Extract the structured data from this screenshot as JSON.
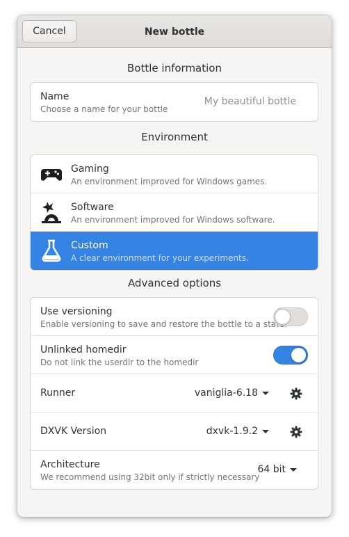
{
  "header": {
    "cancel_label": "Cancel",
    "title": "New bottle"
  },
  "bottle_info": {
    "section_title": "Bottle information",
    "name_label": "Name",
    "name_sub": "Choose a name for your bottle",
    "name_placeholder": "My beautiful bottle"
  },
  "environment": {
    "section_title": "Environment",
    "items": [
      {
        "label": "Gaming",
        "sub": "An environment improved for Windows games.",
        "icon": "gamepad-icon"
      },
      {
        "label": "Software",
        "sub": "An environment improved for Windows software.",
        "icon": "wrench-icon"
      },
      {
        "label": "Custom",
        "sub": "A clear environment for your experiments.",
        "icon": "flask-icon",
        "selected": true
      }
    ]
  },
  "advanced": {
    "section_title": "Advanced options",
    "versioning_label": "Use versioning",
    "versioning_sub": "Enable versioning to save and restore the bottle to a state.",
    "versioning_on": false,
    "homedir_label": "Unlinked homedir",
    "homedir_sub": "Do not link the userdir to the homedir",
    "homedir_on": true,
    "runner_label": "Runner",
    "runner_value": "vaniglia-6.18",
    "dxvk_label": "DXVK Version",
    "dxvk_value": "dxvk-1.9.2",
    "arch_label": "Architecture",
    "arch_sub": "We recommend using 32bit only if strictly necessary",
    "arch_value": "64 bit"
  },
  "colors": {
    "accent": "#3584e4",
    "window_bg": "#f6f5f4"
  }
}
